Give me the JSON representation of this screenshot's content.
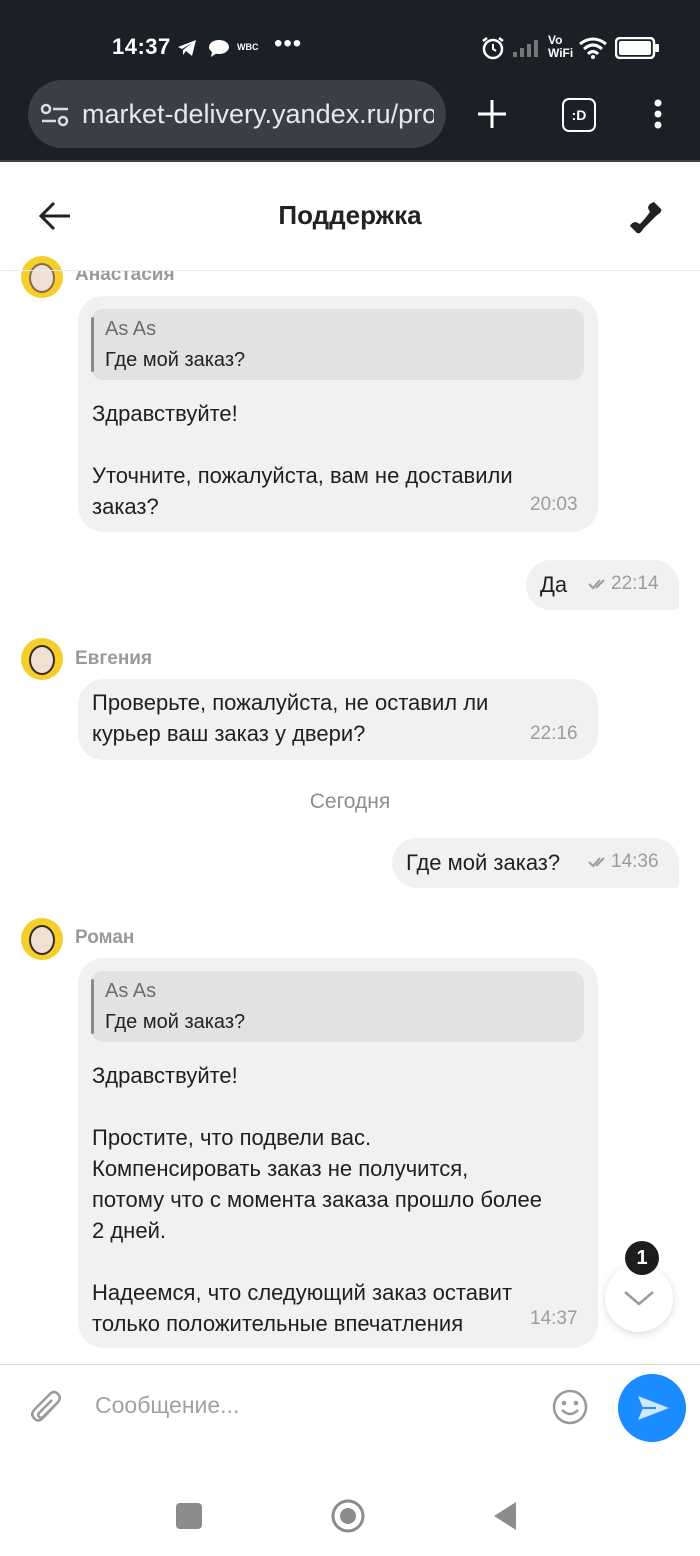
{
  "status_bar": {
    "time": "14:37",
    "carrier_label": "WBC",
    "more": "•••",
    "volte": "Vo",
    "wifi_label": "WiFi"
  },
  "browser": {
    "url": "market-delivery.yandex.ru/pro",
    "tab_label": ":D"
  },
  "header": {
    "title": "Поддержка"
  },
  "messages": [
    {
      "sender": "Анастасия",
      "quote_name": "As As",
      "quote_text": "Где мой заказ?",
      "lines": [
        "Здравствуйте!",
        "",
        "Уточните, пожалуйста, вам не доставили",
        "заказ?"
      ],
      "time": "20:03"
    },
    {
      "outgoing_text": "Да",
      "time": "22:14"
    },
    {
      "sender": "Евгения",
      "lines": [
        "Проверьте, пожалуйста, не оставил ли",
        "курьер ваш заказ у двери?"
      ],
      "time": "22:16"
    },
    {
      "date_separator": "Сегодня"
    },
    {
      "outgoing_text": "Где мой заказ?",
      "time": "14:36"
    },
    {
      "sender": "Роман",
      "quote_name": "As As",
      "quote_text": "Где мой заказ?",
      "lines": [
        "Здравствуйте!",
        "",
        "Простите, что подвели вас.",
        "Компенсировать заказ не получится,",
        "потому что с момента заказа прошло более",
        "2 дней.",
        "",
        "Надеемся, что следующий заказ оставит",
        "только положительные впечатления"
      ],
      "time": "14:37"
    }
  ],
  "scroll_badge": "1",
  "input": {
    "placeholder": "Сообщение..."
  },
  "colors": {
    "accent": "#1a8cff",
    "avatar_bg": "#f4cf2b",
    "bubble": "#f2f1f0"
  }
}
